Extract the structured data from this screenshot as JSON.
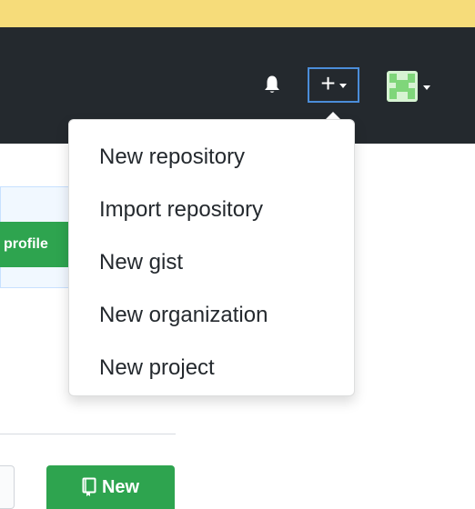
{
  "header": {
    "bell_icon": "bell-icon",
    "create_icon": "plus-icon",
    "avatar_icon": "avatar-icon"
  },
  "page": {
    "profile_button_label": "profile",
    "new_button_label": "New"
  },
  "create_menu": {
    "items": [
      {
        "label": "New repository"
      },
      {
        "label": "Import repository"
      },
      {
        "label": "New gist"
      },
      {
        "label": "New organization"
      },
      {
        "label": "New project"
      }
    ]
  },
  "colors": {
    "banner": "#f6dc7a",
    "header": "#24292e",
    "accent_green": "#2ea44f",
    "focus_blue": "#4b8dd9"
  }
}
